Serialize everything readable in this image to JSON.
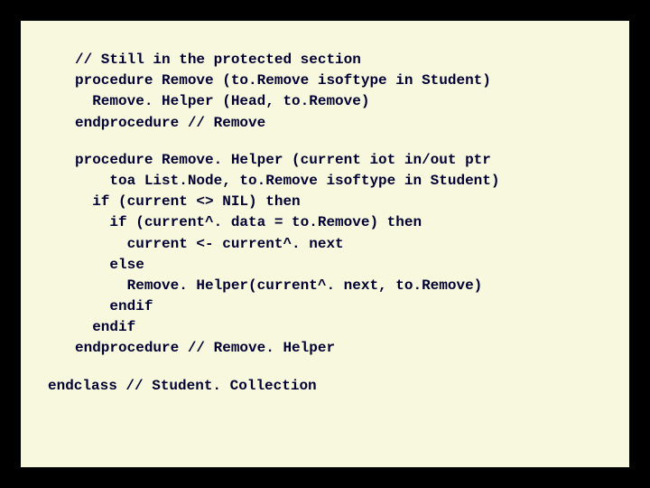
{
  "code": {
    "l01": "// Still in the protected section",
    "l02": "procedure Remove (to.Remove isoftype in Student)",
    "l03": "  Remove. Helper (Head, to.Remove)",
    "l04": "endprocedure // Remove",
    "l05": "procedure Remove. Helper (current iot in/out ptr",
    "l06": "    toa List.Node, to.Remove isoftype in Student)",
    "l07": "  if (current <> NIL) then",
    "l08": "    if (current^. data = to.Remove) then",
    "l09": "      current <- current^. next",
    "l10": "    else",
    "l11": "      Remove. Helper(current^. next, to.Remove)",
    "l12": "    endif",
    "l13": "  endif",
    "l14": "endprocedure // Remove. Helper",
    "l15": "endclass // Student. Collection"
  }
}
